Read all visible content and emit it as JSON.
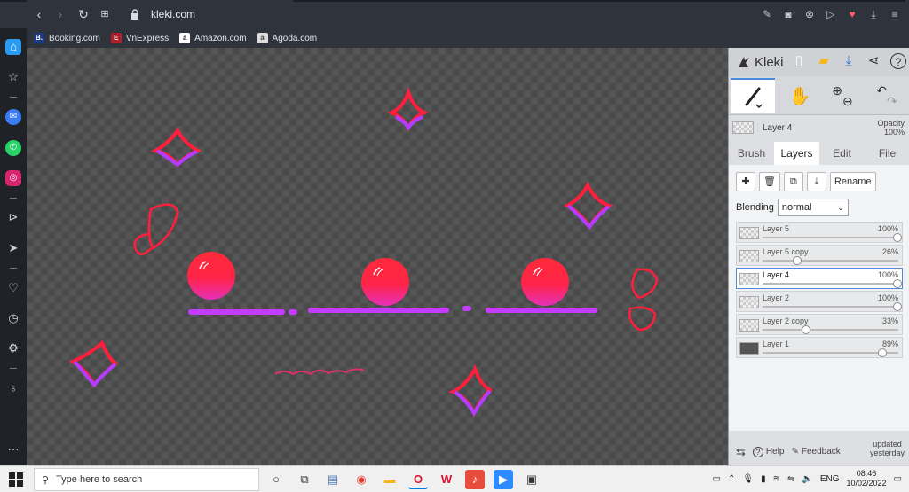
{
  "browser": {
    "url": "kleki.com",
    "bookmarks": [
      {
        "label": "Booking.com",
        "badge": "B.",
        "color": "#1a3a84"
      },
      {
        "label": "VnExpress",
        "badge": "E",
        "color": "#b21e2a"
      },
      {
        "label": "Amazon.com",
        "badge": "a",
        "color": "#222222"
      },
      {
        "label": "Agoda.com",
        "badge": "a",
        "color": "#444444"
      }
    ]
  },
  "sidebar": {
    "icons": [
      "home-icon",
      "star-icon",
      "messenger-icon",
      "whatsapp-icon",
      "instagram-icon",
      "play-icon",
      "send-icon",
      "heart-icon",
      "clock-icon",
      "settings-icon",
      "lightbulb-icon",
      "more-icon"
    ]
  },
  "app": {
    "name": "Kleki",
    "current_layer": "Layer 4",
    "opacity_label": "Opacity",
    "opacity_value": "100%",
    "tabs": [
      "Brush",
      "Layers",
      "Edit",
      "File"
    ],
    "active_tab": "Layers",
    "rename_label": "Rename",
    "blending_label": "Blending",
    "blending_value": "normal",
    "layers": [
      {
        "name": "Layer 5",
        "opacity": "100%",
        "level": 1.0,
        "selected": false,
        "dark": false
      },
      {
        "name": "Layer 5 copy",
        "opacity": "26%",
        "level": 0.26,
        "selected": false,
        "dark": false
      },
      {
        "name": "Layer 4",
        "opacity": "100%",
        "level": 1.0,
        "selected": true,
        "dark": false
      },
      {
        "name": "Layer 2",
        "opacity": "100%",
        "level": 1.0,
        "selected": false,
        "dark": false
      },
      {
        "name": "Layer 2 copy",
        "opacity": "33%",
        "level": 0.33,
        "selected": false,
        "dark": false
      },
      {
        "name": "Layer 1",
        "opacity": "89%",
        "level": 0.89,
        "selected": false,
        "dark": true
      }
    ],
    "help_label": "Help",
    "feedback_label": "Feedback",
    "updated_line1": "updated",
    "updated_line2": "yesterday",
    "accent": "#4a89dc"
  },
  "taskbar": {
    "search_placeholder": "Type here to search",
    "lang": "ENG",
    "time": "08:46",
    "date": "10/02/2022"
  }
}
